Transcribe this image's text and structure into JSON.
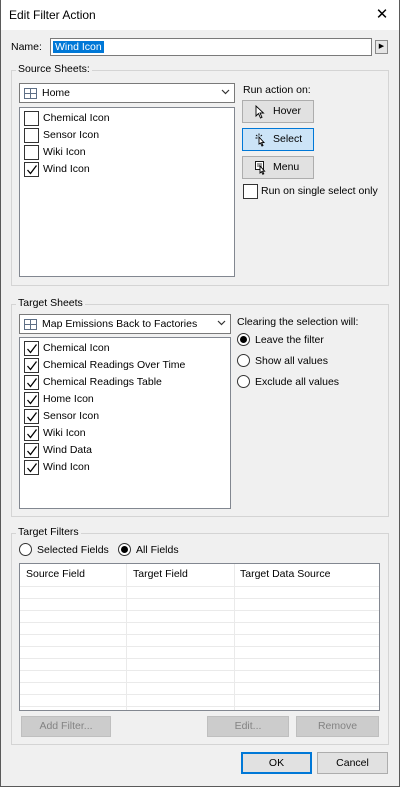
{
  "window": {
    "title": "Edit Filter Action",
    "close_glyph": "✕"
  },
  "name_field": {
    "label": "Name:",
    "value": "Wind Icon",
    "insert_glyph": "▶"
  },
  "source_sheets": {
    "title": "Source Sheets:",
    "dashboard": "Home",
    "items": [
      {
        "label": "Chemical Icon",
        "checked": false
      },
      {
        "label": "Sensor Icon",
        "checked": false
      },
      {
        "label": "Wiki Icon",
        "checked": false
      },
      {
        "label": "Wind Icon",
        "checked": true
      }
    ]
  },
  "run_action": {
    "title": "Run action on:",
    "hover_label": "Hover",
    "select_label": "Select",
    "menu_label": "Menu",
    "selected": "Select",
    "single_select_label": "Run on single select only",
    "single_select_checked": false
  },
  "target_sheets": {
    "title": "Target Sheets",
    "dashboard": "Map Emissions Back to Factories",
    "items": [
      {
        "label": "Chemical Icon",
        "checked": true
      },
      {
        "label": "Chemical Readings Over Time",
        "checked": true
      },
      {
        "label": "Chemical Readings Table",
        "checked": true
      },
      {
        "label": "Home Icon",
        "checked": true
      },
      {
        "label": "Sensor Icon",
        "checked": true
      },
      {
        "label": "Wiki Icon",
        "checked": true
      },
      {
        "label": "Wind Data",
        "checked": true
      },
      {
        "label": "Wind Icon",
        "checked": true
      }
    ]
  },
  "clearing": {
    "title": "Clearing the selection will:",
    "options": [
      "Leave the filter",
      "Show all values",
      "Exclude all values"
    ],
    "selected_index": 0
  },
  "target_filters": {
    "title": "Target Filters",
    "selected_fields_label": "Selected Fields",
    "all_fields_label": "All Fields",
    "selected": "All Fields",
    "columns": [
      "Source Field",
      "Target Field",
      "Target Data Source"
    ],
    "add_filter_label": "Add Filter...",
    "edit_label": "Edit...",
    "remove_label": "Remove"
  },
  "footer": {
    "ok_label": "OK",
    "cancel_label": "Cancel"
  },
  "colors": {
    "accent": "#0078d7",
    "selection_bg": "#cce4f7"
  },
  "icons": {
    "sheet": "dashboard-grid-icon",
    "hover": "cursor-pointer-icon",
    "select": "cursor-click-icon",
    "menu": "cursor-menu-icon"
  }
}
